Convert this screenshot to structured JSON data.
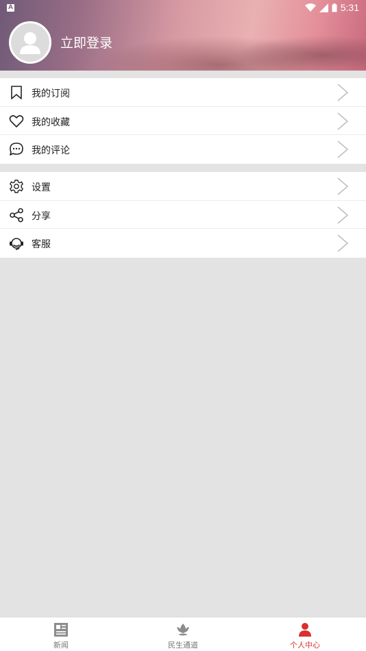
{
  "status_bar": {
    "time": "5:31",
    "app_badge": "A"
  },
  "header": {
    "login_label": "立即登录"
  },
  "menu_group_1": [
    {
      "label": "我的订阅",
      "icon": "bookmark-icon"
    },
    {
      "label": "我的收藏",
      "icon": "heart-icon"
    },
    {
      "label": "我的评论",
      "icon": "comment-icon"
    }
  ],
  "menu_group_2": [
    {
      "label": "设置",
      "icon": "gear-icon"
    },
    {
      "label": "分享",
      "icon": "share-icon"
    },
    {
      "label": "客服",
      "icon": "headset-icon"
    }
  ],
  "bottom_nav": [
    {
      "label": "新闻",
      "icon": "newspaper-icon",
      "active": false
    },
    {
      "label": "民生通道",
      "icon": "lotus-icon",
      "active": false
    },
    {
      "label": "个人中心",
      "icon": "person-icon",
      "active": true
    }
  ],
  "colors": {
    "accent": "#d9302f",
    "background": "#e3e3e3"
  }
}
